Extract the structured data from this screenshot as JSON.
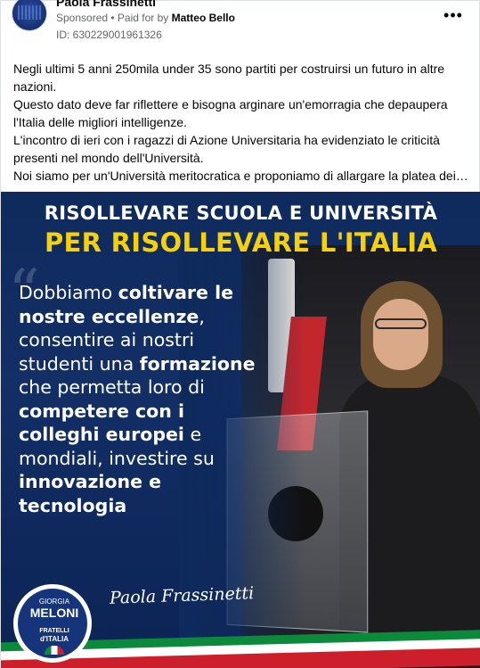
{
  "header": {
    "page_name": "Paola Frassinetti",
    "sponsored": "Sponsored",
    "separator": " • ",
    "paid_prefix": "Paid for by ",
    "payer": "Matteo Bello",
    "ad_id": "ID: 630229001961326",
    "more_icon": "more-dots-icon"
  },
  "post": {
    "paragraphs": [
      "Negli ultimi 5 anni 250mila under 35 sono partiti per costruirsi un futuro in altre nazioni.",
      "Questo dato deve far riflettere e bisogna arginare un'emorragia che depaupera l'Italia delle migliori intelligenze.",
      "L'incontro di ieri con i ragazzi di Azione Universitaria ha evidenziato le criticità presenti nel mondo dell'Università.",
      "Noi siamo per un'Università meritocratica e proponiamo di allargare la platea dei…"
    ]
  },
  "ad_image": {
    "headline_top": "RISOLLEVARE SCUOLA E UNIVERSITÀ",
    "headline_main": "PER RISOLLEVARE L'ITALIA",
    "quote_mark": "“",
    "quote_parts": [
      {
        "t": "Dobbiamo ",
        "b": false
      },
      {
        "t": "coltivare le nostre eccellenze",
        "b": true
      },
      {
        "t": ", consentire ai nostri studenti una ",
        "b": false
      },
      {
        "t": "formazione",
        "b": true
      },
      {
        "t": " che permetta loro di ",
        "b": false
      },
      {
        "t": "competere con i colleghi europei",
        "b": true
      },
      {
        "t": " e mondiali, investire su ",
        "b": false
      },
      {
        "t": "innovazione e tecnologia",
        "b": true
      }
    ],
    "signature": "Paola Frassinetti",
    "logo": {
      "top": "GIORGIA",
      "name": "MELONI",
      "sub1": "FRATELLI",
      "sub2": "d'ITALIA"
    },
    "colors": {
      "navy": "#0f2a5c",
      "yellow": "#f6d10b",
      "green": "#0a8a3a",
      "red": "#cc1f2b"
    }
  }
}
